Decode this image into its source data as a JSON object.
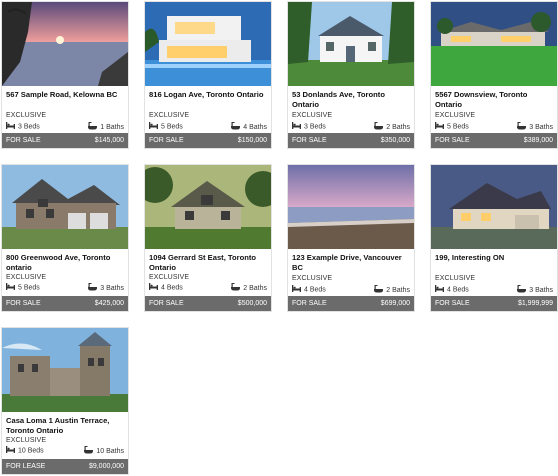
{
  "listings": [
    {
      "address": "567 Sample Road, Kelowna BC",
      "tag": "EXCLUSIVE",
      "beds": "3 Beds",
      "baths": "1 Baths",
      "status": "FOR SALE",
      "price": "$145,000",
      "photo": "sunset-lake"
    },
    {
      "address": "816 Logan Ave, Toronto Ontario",
      "tag": "EXCLUSIVE",
      "beds": "5 Beds",
      "baths": "4 Baths",
      "status": "FOR SALE",
      "price": "$150,000",
      "photo": "modern-villa"
    },
    {
      "address": "53 Donlands Ave, Toronto Ontario",
      "tag": "EXCLUSIVE",
      "beds": "3 Beds",
      "baths": "2 Baths",
      "status": "FOR SALE",
      "price": "$350,000",
      "photo": "colonial-house"
    },
    {
      "address": "5567 Downsview, Toronto Ontario",
      "tag": "EXCLUSIVE",
      "beds": "5 Beds",
      "baths": "3 Baths",
      "status": "FOR SALE",
      "price": "$389,000",
      "photo": "lawn-estate"
    },
    {
      "address": "800 Greenwood Ave, Toronto ontario",
      "tag": "EXCLUSIVE",
      "beds": "5 Beds",
      "baths": "3 Baths",
      "status": "FOR SALE",
      "price": "$425,000",
      "photo": "brick-house"
    },
    {
      "address": "1094 Gerrard St East, Toronto Ontario",
      "tag": "EXCLUSIVE",
      "beds": "4 Beds",
      "baths": "2 Baths",
      "status": "FOR SALE",
      "price": "$500,000",
      "photo": "craftsman-house"
    },
    {
      "address": "123 Example Drive, Vancouver BC",
      "tag": "EXCLUSIVE",
      "beds": "4 Beds",
      "baths": "2 Baths",
      "status": "FOR SALE",
      "price": "$699,000",
      "photo": "beach-dusk"
    },
    {
      "address": "199, Interesting ON",
      "tag": "EXCLUSIVE",
      "beds": "4 Beds",
      "baths": "3 Baths",
      "status": "FOR SALE",
      "price": "$1,999,999",
      "photo": "dusk-house"
    },
    {
      "address": "Casa Loma 1 Austin Terrace, Toronto Ontario",
      "tag": "EXCLUSIVE",
      "beds": "10 Beds",
      "baths": "10 Baths",
      "status": "FOR LEASE",
      "price": "$9,000,000",
      "photo": "castle"
    }
  ]
}
